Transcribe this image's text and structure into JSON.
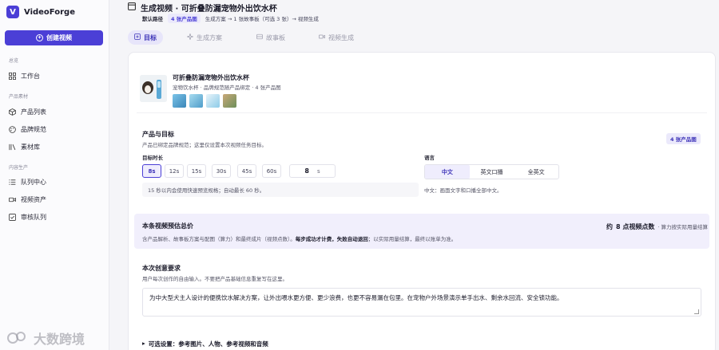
{
  "brand": {
    "name": "VideoForge",
    "logo_letter": "V"
  },
  "sidebar": {
    "create_label": "创建视频",
    "sections": [
      {
        "label": "总览",
        "items": [
          {
            "label": "工作台",
            "icon": "grid-icon"
          }
        ]
      },
      {
        "label": "产品素材",
        "items": [
          {
            "label": "产品列表",
            "icon": "box-icon"
          },
          {
            "label": "品牌规范",
            "icon": "palette-icon"
          },
          {
            "label": "素材库",
            "icon": "library-icon"
          }
        ]
      },
      {
        "label": "内容生产",
        "items": [
          {
            "label": "队列中心",
            "icon": "list-icon"
          },
          {
            "label": "视频资产",
            "icon": "video-icon"
          },
          {
            "label": "审核队列",
            "icon": "check-square-icon"
          }
        ]
      }
    ]
  },
  "header": {
    "title": "生成视频 · 可折叠防漏宠物外出饮水杯",
    "route_label": "默认路径",
    "route_chip": "4 张产品图",
    "route_steps": "生成方案 → 1 张故事板（可选 3 张）→ 视频生成"
  },
  "tabs": [
    {
      "label": "目标",
      "active": true
    },
    {
      "label": "生成方案",
      "active": false
    },
    {
      "label": "故事板",
      "active": false
    },
    {
      "label": "视频生成",
      "active": false
    }
  ],
  "product": {
    "title": "可折叠防漏宠物外出饮水杯",
    "subtitle": "宠物饮水杯 · 品牌规范随产品绑定 · 4 张产品图"
  },
  "goal": {
    "title": "产品与目标",
    "desc": "产品已绑定品牌规范；这里仅设置本次视频任务目标。",
    "badge": "4 张产品图",
    "duration_label": "目标时长",
    "durations": [
      "8s",
      "12s",
      "15s",
      "30s",
      "45s",
      "60s"
    ],
    "selected_duration": "8s",
    "custom_value": "8",
    "custom_unit": "s",
    "duration_hint": "15 秒以内会使用快速预览规格；自动最长 60 秒。",
    "language_label": "语言",
    "languages": [
      "中文",
      "英文口播",
      "全英文"
    ],
    "selected_language": "中文",
    "language_note": "中文：画面文字和口播全部中文。"
  },
  "price": {
    "title": "本条视频预估总价",
    "desc_pre": "含产品解析、故事板方案与配图（算力）和最终成片（视频点数）。",
    "desc_bold": "每步成功才计费，失败自动退回",
    "desc_post": "；以实际用量结算，最终以账单为准。",
    "value_prefix": "约",
    "value": "8 点视频点数",
    "value_suffix": "· 算力按实际用量结算"
  },
  "requirement": {
    "title": "本次创意要求",
    "desc": "用户每次创作的自由输入。不要把产品基础信息重复写在这里。",
    "value": "为中大型犬主人设计的便携饮水解决方案，让外出喂水更方便、更少浪费，也更不容易漏在包里。在宠物户外场景演示单手出水、剩余水回流、安全锁功能。"
  },
  "optional": {
    "arrow": "▸",
    "label": "可选设置：参考图片、人物、参考视频和音频"
  },
  "watermark": {
    "text": "大数跨境"
  },
  "colors": {
    "accent": "#4b3fd6",
    "accent_soft": "#ebe9fb",
    "price_bg": "#f1effc"
  }
}
